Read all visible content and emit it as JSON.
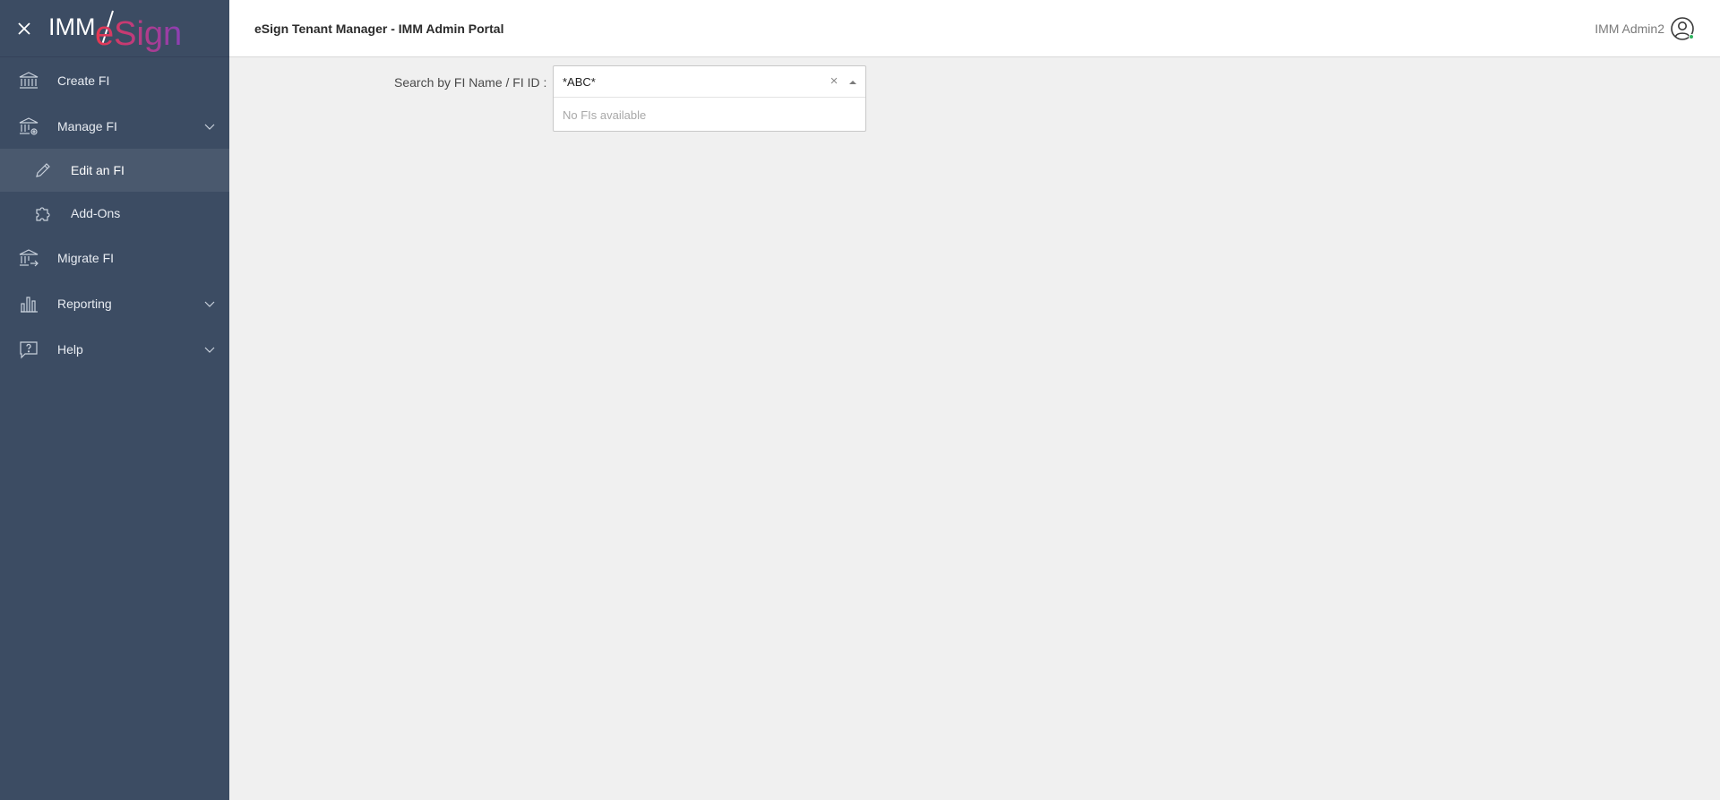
{
  "brand": {
    "logo_left": "IMM",
    "logo_right": "eSign"
  },
  "header": {
    "title": "eSign Tenant Manager - IMM Admin Portal",
    "user_name": "IMM Admin2"
  },
  "sidebar": {
    "items": [
      {
        "label": "Create FI",
        "icon": "bank-icon"
      },
      {
        "label": "Manage FI",
        "icon": "bank-gear-icon",
        "expanded": true,
        "children": [
          {
            "label": "Edit an FI",
            "icon": "pencil-icon",
            "active": true
          },
          {
            "label": "Add-Ons",
            "icon": "puzzle-icon"
          }
        ]
      },
      {
        "label": "Migrate FI",
        "icon": "bank-arrow-icon"
      },
      {
        "label": "Reporting",
        "icon": "bar-chart-icon"
      },
      {
        "label": "Help",
        "icon": "help-bubble-icon"
      }
    ]
  },
  "search": {
    "label": "Search by FI Name / FI ID :",
    "value": "*ABC*",
    "clear_symbol": "×",
    "no_results": "No FIs available"
  },
  "colors": {
    "sidebar_bg": "#3c4c63",
    "sidebar_active": "#4a596e",
    "logo_gradient_start": "#e8384f",
    "logo_gradient_end": "#8a3fb5",
    "online_dot": "#2db35e"
  }
}
